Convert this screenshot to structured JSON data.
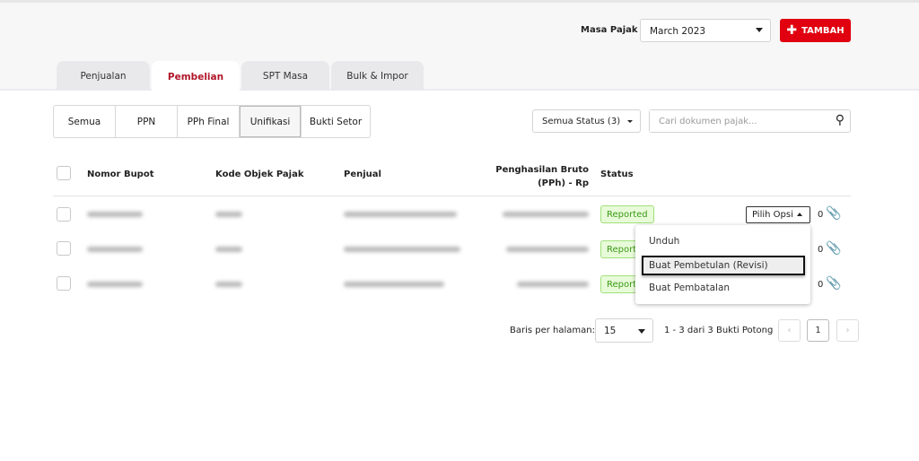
{
  "header": {
    "masa_pajak_label": "Masa Pajak",
    "masa_pajak_value": "March  2023",
    "add_label": "TAMBAH",
    "accent": "#e0000f"
  },
  "tabs": [
    {
      "label": "Penjualan"
    },
    {
      "label": "Pembelian",
      "active": true
    },
    {
      "label": "SPT Masa"
    },
    {
      "label": "Bulk & Impor"
    }
  ],
  "filters": [
    {
      "label": "Semua"
    },
    {
      "label": "PPN"
    },
    {
      "label": "PPh Final"
    },
    {
      "label": "Unifikasi",
      "active": true
    },
    {
      "label": "Bukti Setor"
    }
  ],
  "status_filter": "Semua Status (3)",
  "search_placeholder": "Cari dokumen pajak...",
  "table": {
    "columns": [
      "Nomor Bupot",
      "Kode Objek Pajak",
      "Penjual",
      "Penghasilan Bruto (PPh) - Rp",
      "Status"
    ],
    "rows": [
      {
        "status": "Reported",
        "attachments": "0"
      },
      {
        "status": "Reported",
        "attachments": "0"
      },
      {
        "status": "Reported",
        "attachments": "0"
      }
    ]
  },
  "row_action": "Pilih Opsi",
  "menu": [
    "Unduh",
    "Buat Pembetulan (Revisi)",
    "Buat Pembatalan"
  ],
  "pagination": {
    "rows_label": "Baris per halaman:",
    "rows_value": "15",
    "range": "1 - 3 dari 3 Bukti Potong",
    "page": "1",
    "prev": "‹",
    "next": "›"
  }
}
